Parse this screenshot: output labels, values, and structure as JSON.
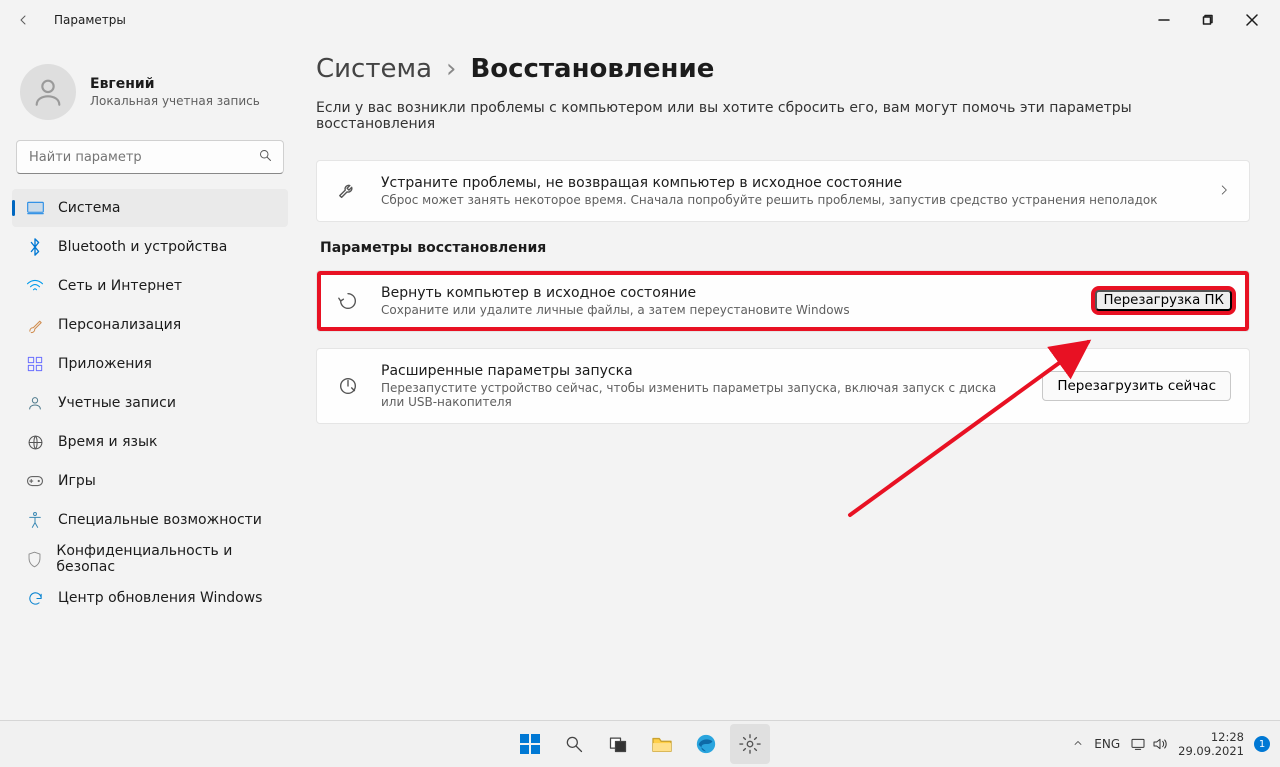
{
  "titlebar": {
    "title": "Параметры"
  },
  "profile": {
    "name": "Евгений",
    "sub": "Локальная учетная запись"
  },
  "search": {
    "placeholder": "Найти параметр"
  },
  "nav": {
    "items": [
      {
        "label": "Система"
      },
      {
        "label": "Bluetooth и устройства"
      },
      {
        "label": "Сеть и Интернет"
      },
      {
        "label": "Персонализация"
      },
      {
        "label": "Приложения"
      },
      {
        "label": "Учетные записи"
      },
      {
        "label": "Время и язык"
      },
      {
        "label": "Игры"
      },
      {
        "label": "Специальные возможности"
      },
      {
        "label": "Конфиденциальность и безопас"
      },
      {
        "label": "Центр обновления Windows"
      }
    ]
  },
  "breadcrumb": {
    "parent": "Система",
    "sep": "›",
    "current": "Восстановление"
  },
  "intro": "Если у вас возникли проблемы с компьютером или вы хотите сбросить его, вам могут помочь эти параметры восстановления",
  "card_troubleshoot": {
    "title": "Устраните проблемы, не возвращая компьютер в исходное состояние",
    "sub": "Сброс может занять некоторое время. Сначала попробуйте решить проблемы, запустив средство устранения неполадок"
  },
  "section_recovery_title": "Параметры восстановления",
  "card_reset": {
    "title": "Вернуть компьютер в исходное состояние",
    "sub": "Сохраните или удалите личные файлы, а затем переустановите Windows",
    "button": "Перезагрузка ПК"
  },
  "card_advanced": {
    "title": "Расширенные параметры запуска",
    "sub": "Перезапустите устройство сейчас, чтобы изменить параметры запуска, включая запуск с диска или USB-накопителя",
    "button": "Перезагрузить сейчас"
  },
  "taskbar": {
    "lang": "ENG",
    "time": "12:28",
    "date": "29.09.2021",
    "notif": "1"
  }
}
